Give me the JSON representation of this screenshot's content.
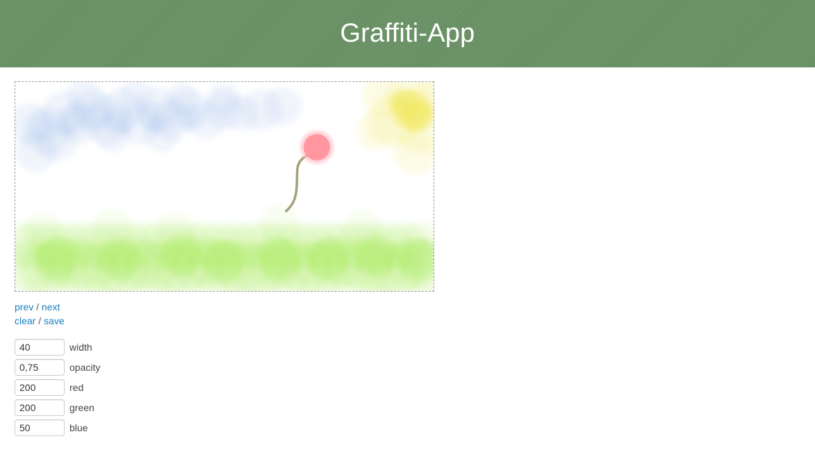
{
  "header": {
    "title": "Graffiti-App"
  },
  "nav": {
    "prev": "prev",
    "next": "next",
    "clear": "clear",
    "save": "save",
    "separator": " / "
  },
  "controls": [
    {
      "label": "width",
      "value": "40"
    },
    {
      "label": "opacity",
      "value": "0,75"
    },
    {
      "label": "red",
      "value": "200"
    },
    {
      "label": "green",
      "value": "200"
    },
    {
      "label": "blue",
      "value": "50"
    }
  ],
  "colors": {
    "header_bg": "#6c9467",
    "link": "#1a7fc1",
    "sky": "#a9c3ec",
    "sun": "#f0e650",
    "grass": "#a6ea56",
    "balloon": "#ff8c97",
    "string": "#a5a07a"
  }
}
